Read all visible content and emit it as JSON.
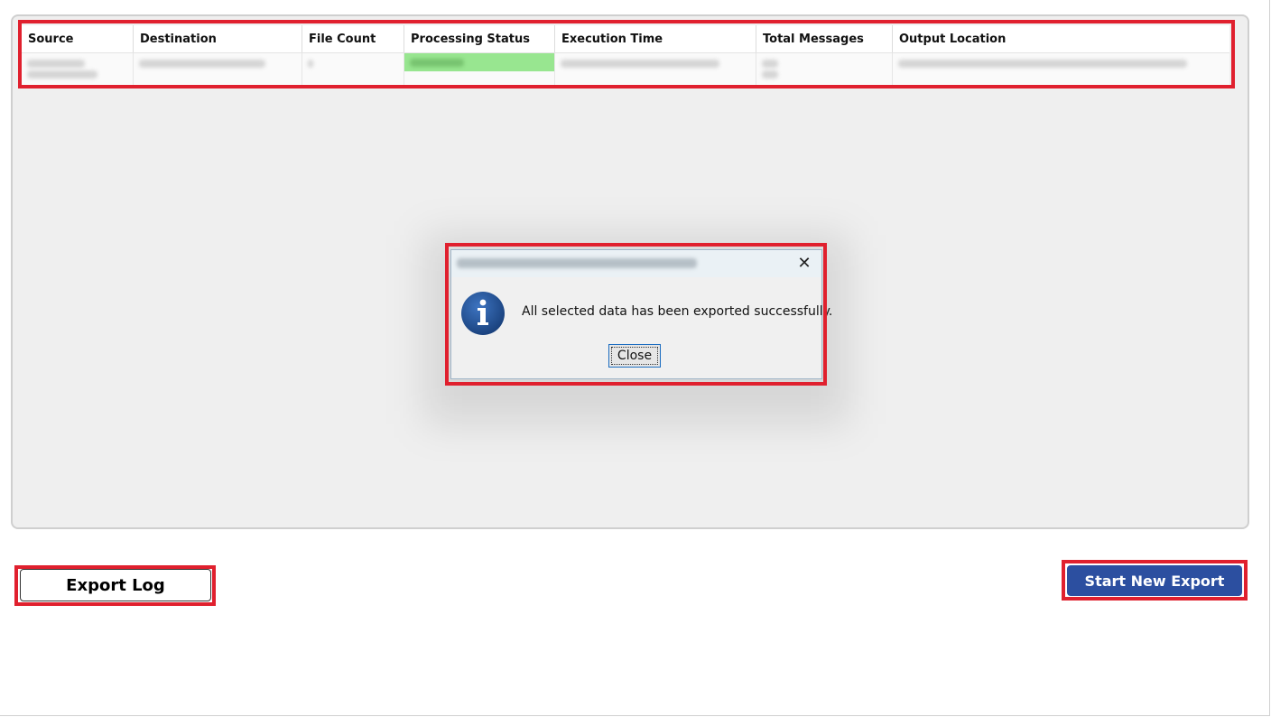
{
  "table": {
    "columns": [
      "Source",
      "Destination",
      "File Count",
      "Processing Status",
      "Execution Time",
      "Total Messages",
      "Output Location"
    ]
  },
  "dialog": {
    "message": "All selected data has been exported successfully.",
    "close_label": "Close",
    "close_glyph": "✕",
    "icon": "info-icon",
    "icon_color": "#1f4f8f"
  },
  "actions": {
    "export_log_label": "Export Log",
    "start_new_export_label": "Start New Export",
    "start_new_export_color": "#2c4fa0"
  },
  "colors": {
    "highlight": "#e0202e",
    "status_success": "#98e690"
  }
}
